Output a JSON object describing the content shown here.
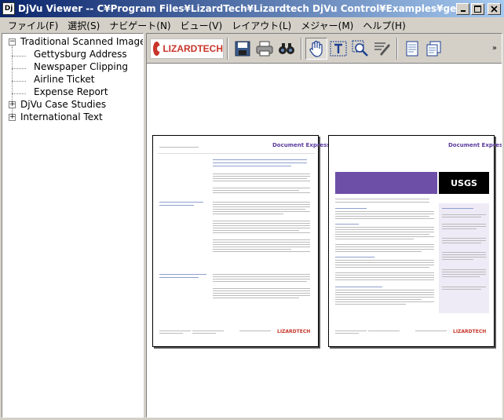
{
  "window": {
    "title": "DjVu Viewer -- C¥Program Files¥LizardTech¥Lizardtech DjVu Control¥Examples¥general.djvu",
    "icon_label": "Dj"
  },
  "menu": [
    "ファイル(F)",
    "選択(S)",
    "ナビゲート(N)",
    "ビュー(V)",
    "レイアウト(L)",
    "メジャー(M)",
    "ヘルプ(H)"
  ],
  "tree": {
    "items": [
      {
        "label": "Traditional Scanned Images",
        "expander": "−",
        "level": 0
      },
      {
        "label": "Gettysburg Address",
        "level": 1
      },
      {
        "label": "Newspaper Clipping",
        "level": 1
      },
      {
        "label": "Airline Ticket",
        "level": 1
      },
      {
        "label": "Expense Report",
        "level": 1
      },
      {
        "label": "DjVu Case Studies",
        "expander": "+",
        "level": 0
      },
      {
        "label": "International Text",
        "expander": "+",
        "level": 0
      }
    ]
  },
  "toolbar": {
    "logo_text": "LIZARDTECH",
    "buttons": [
      "save-icon",
      "print-icon",
      "find-icon",
      "hand-icon",
      "text-select-icon",
      "zoom-icon",
      "highlight-icon",
      "single-page-icon",
      "continuous-page-icon"
    ],
    "more": "»"
  },
  "pages": {
    "left": {
      "brand": "Document Express",
      "footer_brand": "LIZARDTECH"
    },
    "right": {
      "brand": "Document Express",
      "badge": "USGS",
      "footer_brand": "LIZARDTECH"
    }
  },
  "colors": {
    "titlebar_start": "#0a246a",
    "titlebar_end": "#a6caf0",
    "brand_red": "#c8352a",
    "brand_purple": "#5b3a9e"
  }
}
